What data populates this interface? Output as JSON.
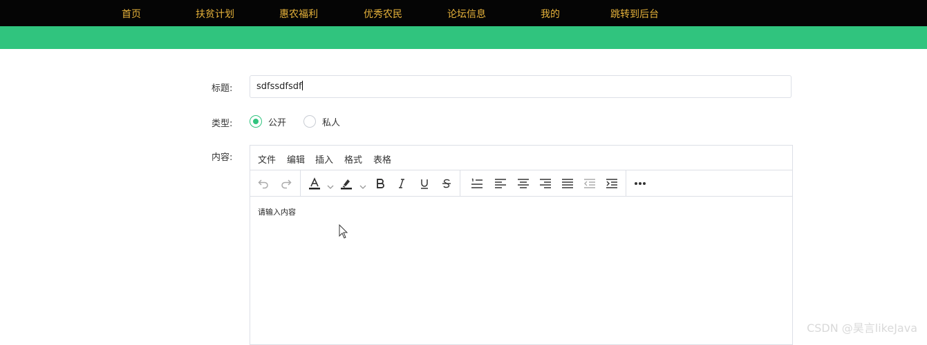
{
  "nav": {
    "items": [
      "首页",
      "扶贫计划",
      "惠农福利",
      "优秀农民",
      "论坛信息",
      "我的",
      "跳转到后台"
    ]
  },
  "form": {
    "title_label": "标题:",
    "title_value": "sdfssdfsdf",
    "type_label": "类型:",
    "type_options": [
      "公开",
      "私人"
    ],
    "type_selected": "公开",
    "content_label": "内容:"
  },
  "editor": {
    "menu": [
      "文件",
      "编辑",
      "插入",
      "格式",
      "表格"
    ],
    "toolbar_icons": [
      "undo-icon",
      "redo-icon",
      "text-color-icon",
      "highlight-color-icon",
      "bold-icon",
      "italic-icon",
      "underline-icon",
      "strikethrough-icon",
      "list-icon",
      "align-left-icon",
      "align-center-icon",
      "align-right-icon",
      "align-justify-icon",
      "outdent-icon",
      "indent-icon",
      "more-icon"
    ],
    "placeholder": "请输入内容"
  },
  "watermark": "CSDN @昊言likeJava",
  "colors": {
    "nav_bg": "#050505",
    "nav_text": "#e6b23a",
    "accent_green": "#30c47e"
  }
}
